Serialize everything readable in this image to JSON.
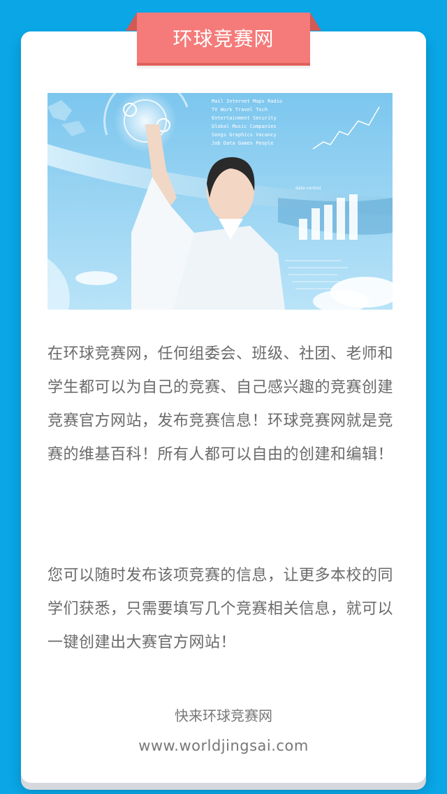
{
  "ribbon": {
    "title": "环球竞赛网"
  },
  "hero": {
    "screen_text_lines": [
      "Mail  Internet  Maps  Radio",
      "TV  Work  Travel  Tech",
      "Entertainment  Security",
      "Global  Music  Companies",
      "Songs  Graphics  Vacancy",
      "Job  Data  Games  People"
    ],
    "chart_caption": "data control"
  },
  "content": {
    "paragraph_1": "在环球竞赛网，任何组委会、班级、社团、老师和学生都可以为自己的竞赛、自己感兴趣的竞赛创建竞赛官方网站，发布竞赛信息！环球竞赛网就是竞赛的维基百科！所有人都可以自由的创建和编辑！",
    "paragraph_2": "您可以随时发布该项竞赛的信息，让更多本校的同学们获悉，只需要填写几个竞赛相关信息，就可以一键创建出大赛官方网站！"
  },
  "footer": {
    "slogan": "快来环球竞赛网",
    "url": "www.worldjingsai.com"
  },
  "colors": {
    "background": "#0aa6e6",
    "ribbon": "#f47b79",
    "text": "#6a6a6a"
  }
}
